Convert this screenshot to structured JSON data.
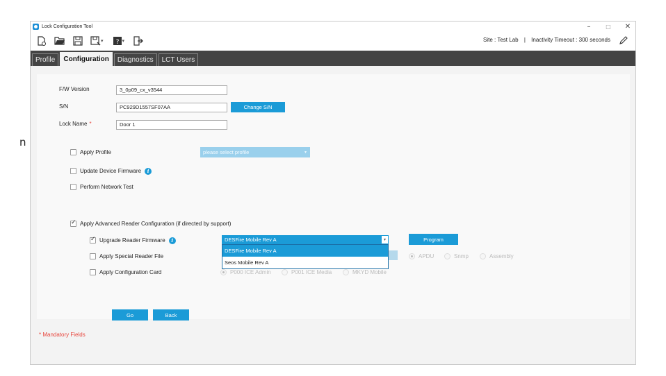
{
  "window": {
    "title": "Lock Configuration Tool",
    "controls": {
      "minimize": "–",
      "maximize": "□",
      "close": "✕"
    }
  },
  "edge_glyph": "n",
  "toolbar": {
    "icons": [
      "new-file-icon",
      "open-folder-icon",
      "save-icon",
      "save-as-icon",
      "help-icon",
      "exit-icon"
    ],
    "site_label": "Site :",
    "site_value": "Test Lab",
    "separator": "|",
    "timeout_label": "Inactivity Timeout :",
    "timeout_value": "300 seconds"
  },
  "tabs": [
    {
      "label": "Profile",
      "active": false
    },
    {
      "label": "Configuration",
      "active": true
    },
    {
      "label": "Diagnostics",
      "active": false
    },
    {
      "label": "LCT Users",
      "active": false
    }
  ],
  "form": {
    "fw_version_label": "F/W Version",
    "fw_version_value": "3_0p09_cx_v3544",
    "sn_label": "S/N",
    "sn_value": "PC929D1557SF07AA",
    "change_sn_label": "Change S/N",
    "lock_name_label": "Lock Name",
    "required_marker": "*",
    "lock_name_value": "Door 1",
    "apply_profile_label": "Apply Profile",
    "profile_placeholder": "please select profile",
    "update_fw_label": "Update Device Firmware",
    "network_test_label": "Perform Network Test",
    "advanced_label": "Apply Advanced Reader Configuration (if directed by support)",
    "upgrade_reader_fw_label": "Upgrade Reader Firmware",
    "reader_fw_selected": "DESFire Mobile Rev A",
    "reader_fw_options": [
      "DESFire Mobile Rev A",
      "Seos Mobile Rev A"
    ],
    "program_label": "Program",
    "special_reader_file_label": "Apply Special Reader File",
    "file_types": [
      "APDU",
      "Snmp",
      "Assembly"
    ],
    "config_card_label": "Apply Configuration Card",
    "card_options": [
      "P000 ICE Admin",
      "P001 ICE Media",
      "MKYD Mobile"
    ],
    "go_label": "Go",
    "back_label": "Back",
    "mandatory_note": "* Mandatory Fields"
  },
  "colors": {
    "accent": "#1b9bd7",
    "tabbar": "#444444",
    "required": "#e8453c"
  }
}
